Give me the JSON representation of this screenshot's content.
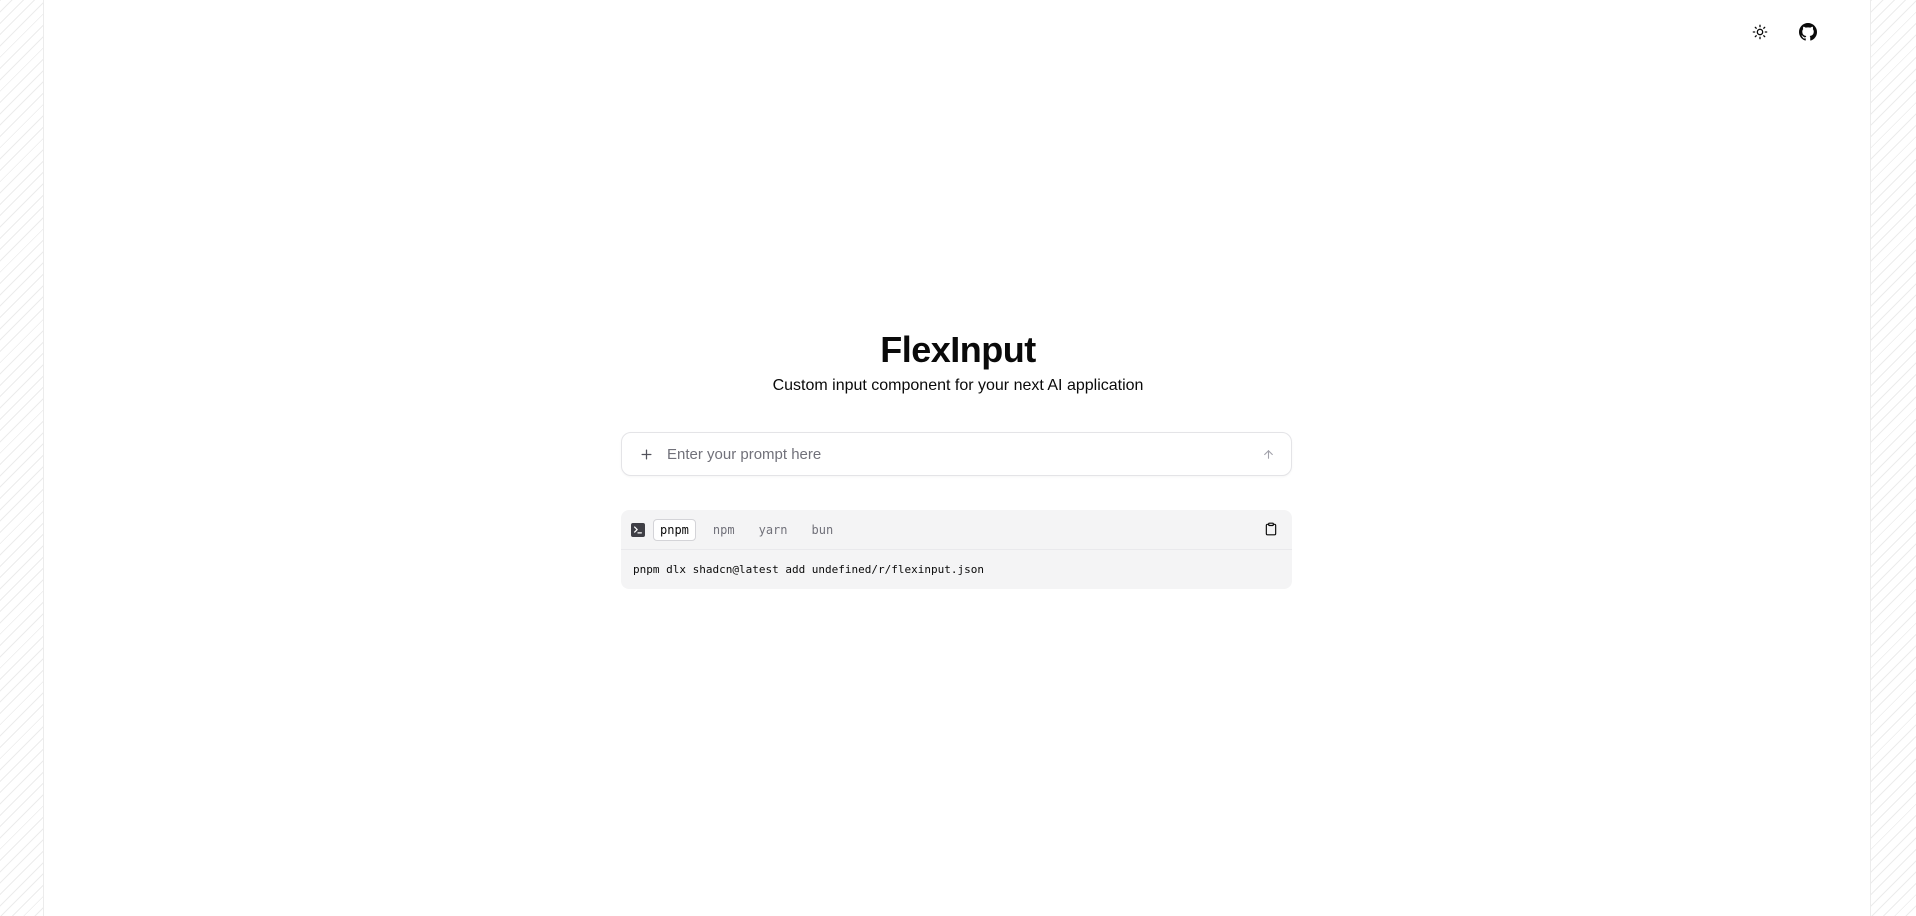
{
  "header": {
    "theme_toggle_icon": "sun-icon",
    "github_icon": "github-icon"
  },
  "hero": {
    "title": "FlexInput",
    "subtitle": "Custom input component for your next AI application"
  },
  "prompt": {
    "placeholder": "Enter your prompt here",
    "value": "",
    "attach_icon": "plus-icon",
    "send_icon": "arrow-up-icon"
  },
  "install": {
    "terminal_icon": "terminal-icon",
    "copy_icon": "clipboard-icon",
    "tabs": [
      {
        "label": "pnpm",
        "active": true
      },
      {
        "label": "npm",
        "active": false
      },
      {
        "label": "yarn",
        "active": false
      },
      {
        "label": "bun",
        "active": false
      }
    ],
    "command": "pnpm dlx shadcn@latest add undefined/r/flexinput.json"
  }
}
